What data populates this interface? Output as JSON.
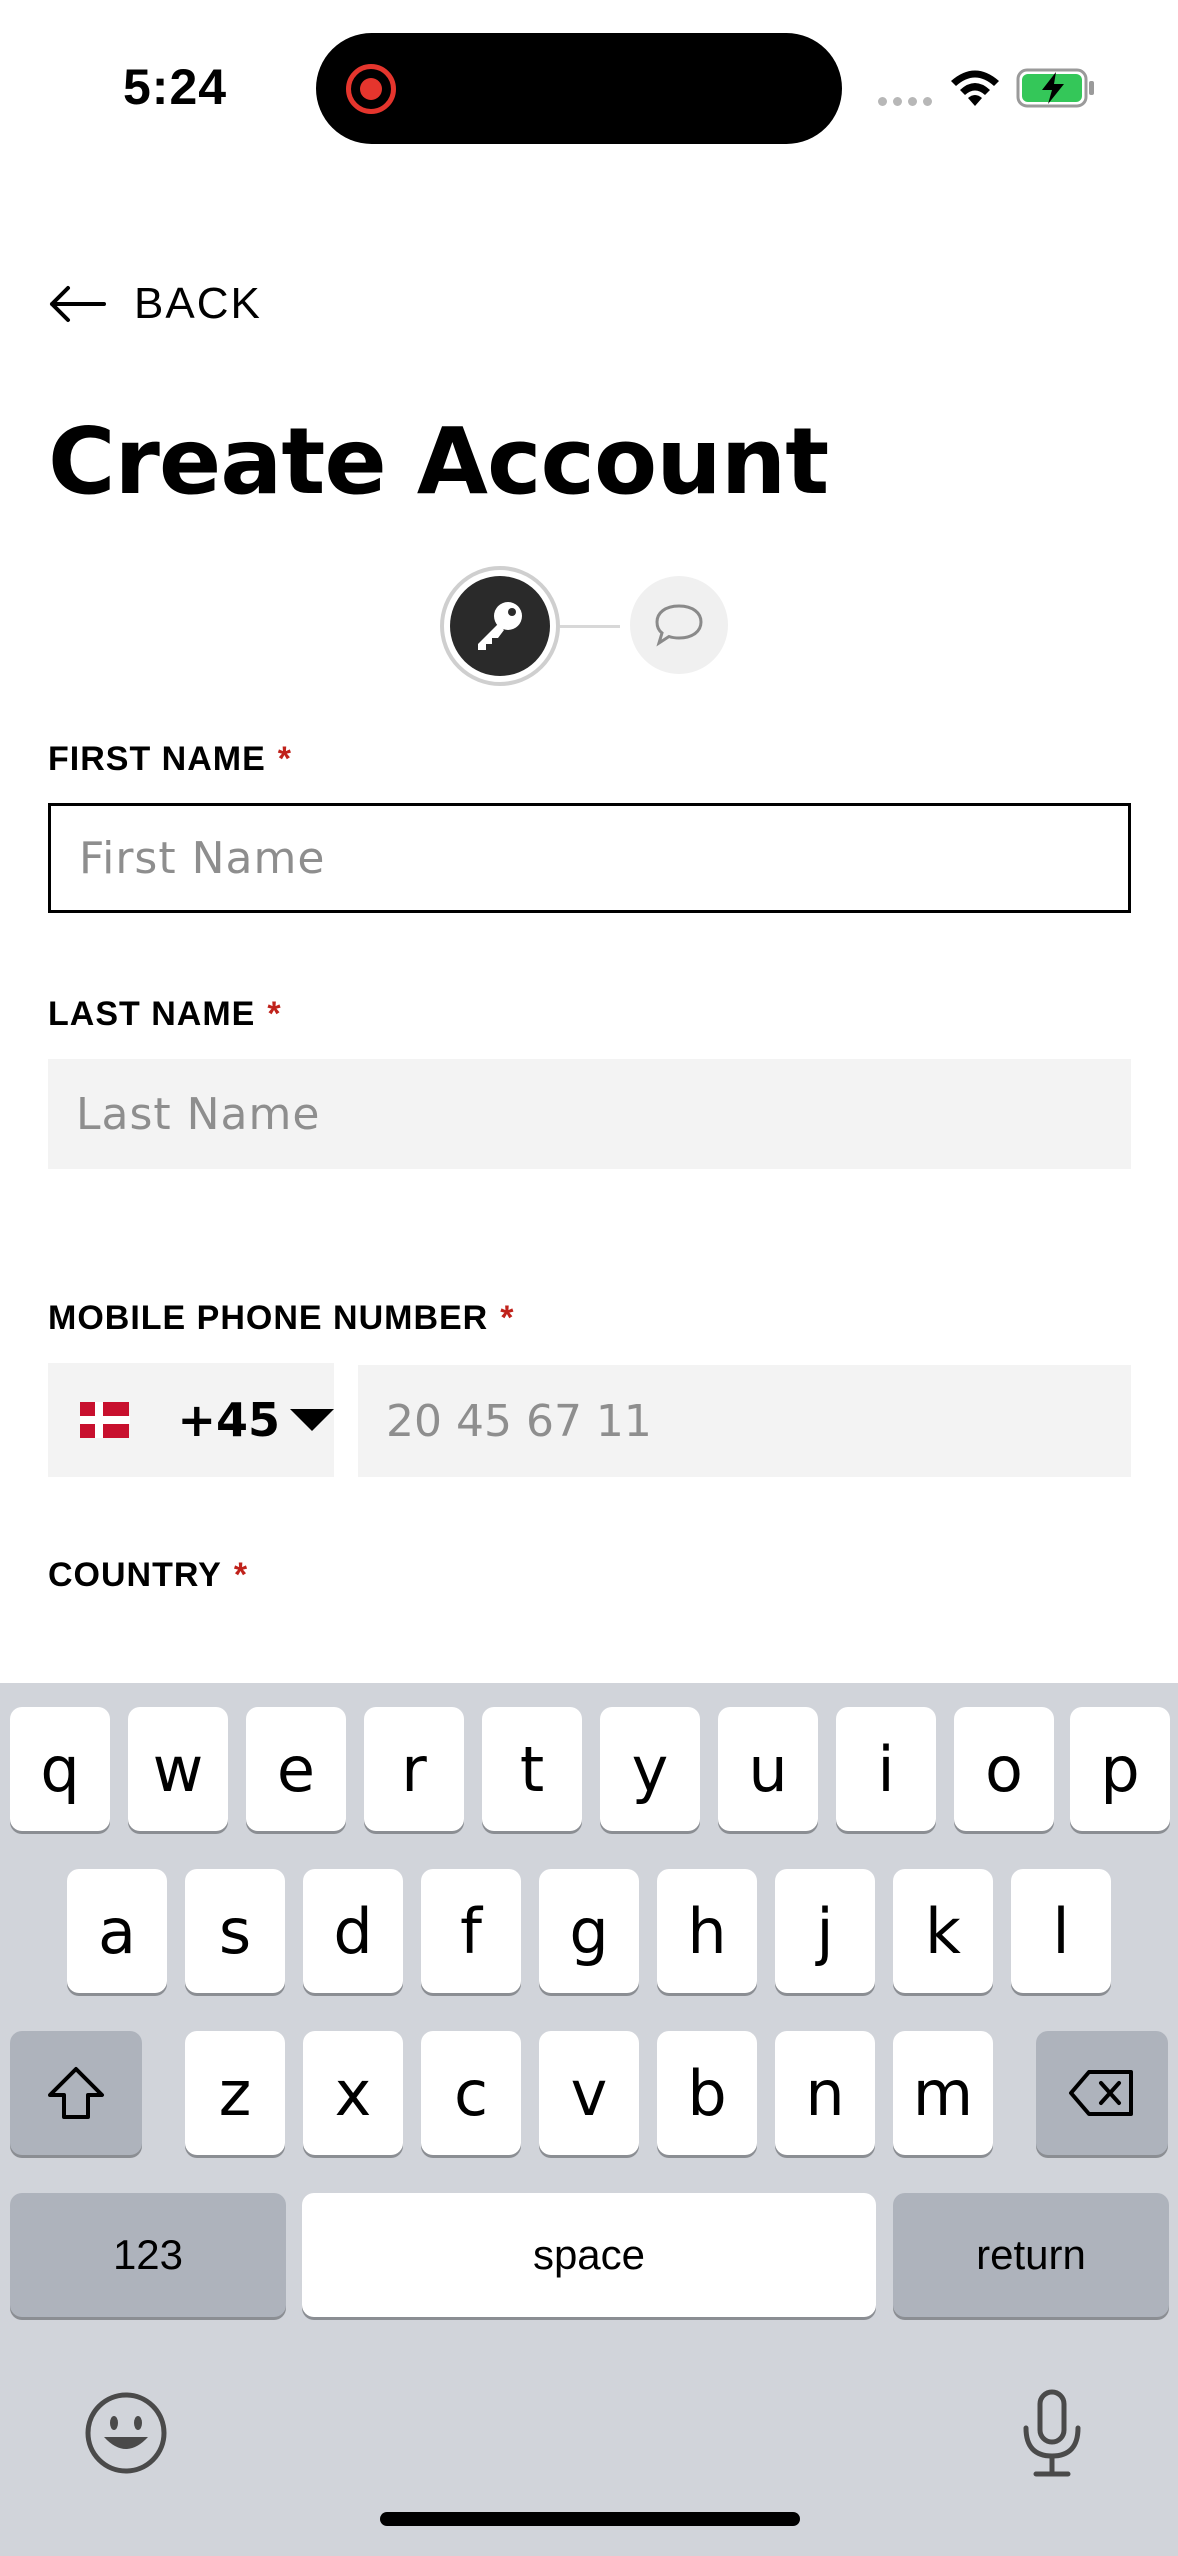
{
  "status_bar": {
    "time": "5:24"
  },
  "nav": {
    "back_label": "BACK"
  },
  "page": {
    "title": "Create Account"
  },
  "form": {
    "required_marker": "*",
    "first_name": {
      "label": "FIRST NAME",
      "placeholder": "First Name"
    },
    "last_name": {
      "label": "LAST NAME",
      "placeholder": "Last Name"
    },
    "mobile": {
      "label": "MOBILE PHONE NUMBER",
      "country_code": "+45",
      "placeholder": "20 45 67 11"
    },
    "country": {
      "label": "COUNTRY"
    }
  },
  "keyboard": {
    "row1": [
      "q",
      "w",
      "e",
      "r",
      "t",
      "y",
      "u",
      "i",
      "o",
      "p"
    ],
    "row2": [
      "a",
      "s",
      "d",
      "f",
      "g",
      "h",
      "j",
      "k",
      "l"
    ],
    "row3": [
      "z",
      "x",
      "c",
      "v",
      "b",
      "n",
      "m"
    ],
    "numbers_label": "123",
    "space_label": "space",
    "return_label": "return"
  }
}
